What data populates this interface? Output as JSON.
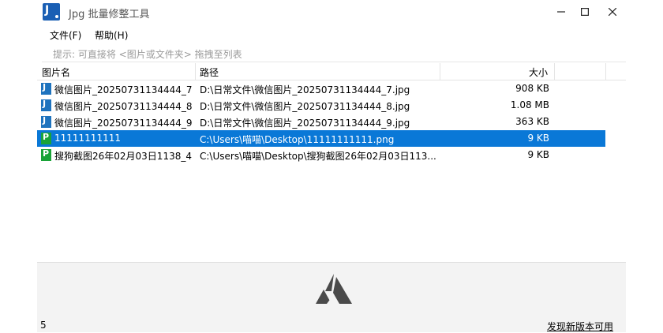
{
  "window": {
    "title": "Jpg 批量修整工具",
    "app_icon_letter": "J"
  },
  "controls": {
    "minimize": "—",
    "maximize": "☐",
    "close": "✕"
  },
  "menu": {
    "file": "文件(F)",
    "help": "帮助(H)"
  },
  "hint": "提示: 可直接将 <图片或文件夹> 拖拽至列表",
  "columns": {
    "name": "图片名",
    "path": "路径",
    "size": "大小"
  },
  "rows": [
    {
      "type": "jpg",
      "icon": "jpg-file-icon",
      "name": "微信图片_20250731134444_7",
      "path": "D:\\日常文件\\微信图片_20250731134444_7.jpg",
      "size": "908 KB",
      "selected": false
    },
    {
      "type": "jpg",
      "icon": "jpg-file-icon",
      "name": "微信图片_20250731134444_8",
      "path": "D:\\日常文件\\微信图片_20250731134444_8.jpg",
      "size": "1.08 MB",
      "selected": false
    },
    {
      "type": "jpg",
      "icon": "jpg-file-icon",
      "name": "微信图片_20250731134444_9",
      "path": "D:\\日常文件\\微信图片_20250731134444_9.jpg",
      "size": "363 KB",
      "selected": false
    },
    {
      "type": "png",
      "icon": "png-file-icon",
      "name": "11111111111",
      "path": "C:\\Users\\喵喵\\Desktop\\11111111111.png",
      "size": "9 KB",
      "selected": true
    },
    {
      "type": "png",
      "icon": "png-file-icon",
      "name": "搜狗截图26年02月03日1138_4",
      "path": "C:\\Users\\喵喵\\Desktop\\搜狗截图26年02月03日113...",
      "size": "9 KB",
      "selected": false
    }
  ],
  "status": {
    "count": "5",
    "update_link": "发现新版本可用"
  },
  "colors": {
    "selection": "#0a78d7",
    "jpg_icon": "#1e73be",
    "png_icon": "#1aa338"
  }
}
